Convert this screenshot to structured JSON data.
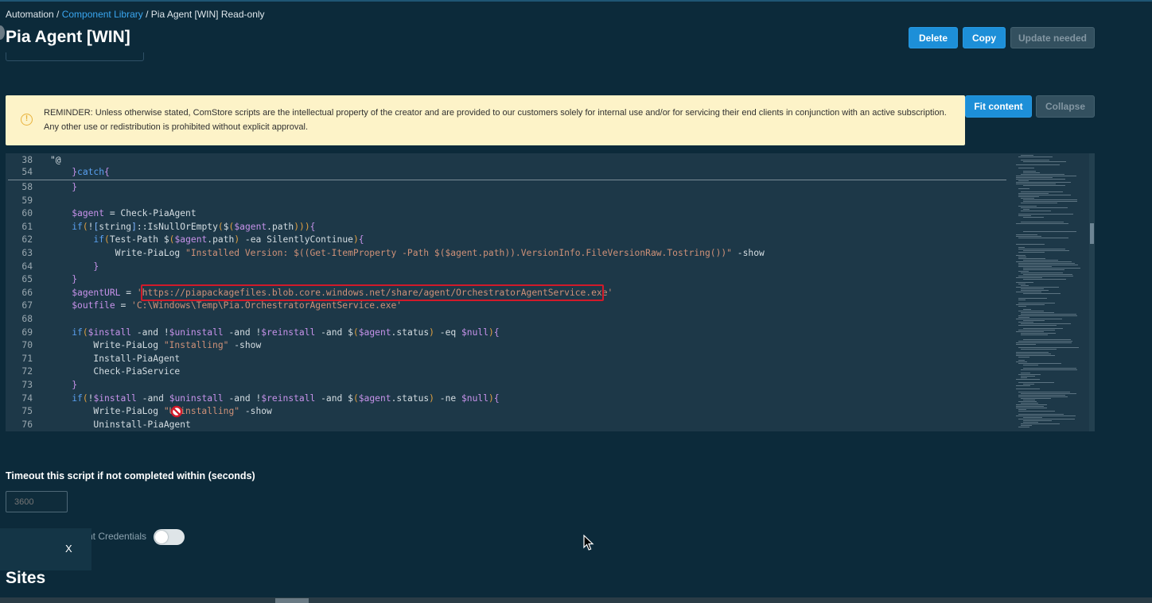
{
  "breadcrumb": {
    "root": "Automation",
    "sep1": " / ",
    "library": "Component Library",
    "sep2": " / ",
    "current": "Pia Agent [WIN] Read-only"
  },
  "page": {
    "title": "Pia Agent [WIN]"
  },
  "actions": {
    "delete_label": "Delete",
    "copy_label": "Copy",
    "update_label": "Update needed",
    "fit_label": "Fit content",
    "collapse_label": "Collapse"
  },
  "reminder": {
    "icon": "warning-circle-icon",
    "text": "REMINDER: Unless otherwise stated, ComStore scripts are the intellectual property of the creator and are provided to our customers solely for internal use and/or for servicing their end clients in conjunction with an active subscription. Any other use or redistribution is prohibited without explicit approval."
  },
  "editor": {
    "lines": [
      {
        "n": "38",
        "code": "\"@"
      },
      {
        "n": "54",
        "code": "    }catch{"
      },
      {
        "n": "58",
        "code": "    }"
      },
      {
        "n": "59",
        "code": ""
      },
      {
        "n": "60",
        "code": "    $agent = Check-PiaAgent"
      },
      {
        "n": "61",
        "code": "    if(![string]::IsNullOrEmpty($($agent.path))){"
      },
      {
        "n": "62",
        "code": "        if(Test-Path $($agent.path) -ea SilentlyContinue){"
      },
      {
        "n": "63",
        "code": "            Write-PiaLog \"Installed Version: $((Get-ItemProperty -Path $($agent.path)).VersionInfo.FileVersionRaw.Tostring())\" -show"
      },
      {
        "n": "64",
        "code": "        }"
      },
      {
        "n": "65",
        "code": "    }"
      },
      {
        "n": "66",
        "code": "    $agentURL = 'https://piapackagefiles.blob.core.windows.net/share/agent/OrchestratorAgentService.exe'"
      },
      {
        "n": "67",
        "code": "    $outfile = 'C:\\Windows\\Temp\\Pia.OrchestratorAgentService.exe'"
      },
      {
        "n": "68",
        "code": ""
      },
      {
        "n": "69",
        "code": "    if($install -and !$uninstall -and !$reinstall -and $($agent.status) -eq $null){"
      },
      {
        "n": "70",
        "code": "        Write-PiaLog \"Installing\" -show"
      },
      {
        "n": "71",
        "code": "        Install-PiaAgent"
      },
      {
        "n": "72",
        "code": "        Check-PiaService"
      },
      {
        "n": "73",
        "code": "    }"
      },
      {
        "n": "74",
        "code": "    if(!$install -and $uninstall -and !$reinstall -and $($agent.status) -ne $null){"
      },
      {
        "n": "75",
        "code": "        Write-PiaLog \"Uninstalling\" -show"
      },
      {
        "n": "76",
        "code": "        Uninstall-PiaAgent"
      }
    ]
  },
  "timeout": {
    "label": "Timeout this script if not completed within (seconds)",
    "value": "",
    "placeholder": "3600"
  },
  "credentials": {
    "label": "nt Credentials",
    "enabled": false
  },
  "toast": {
    "close_label": "X"
  },
  "sites": {
    "title": "Sites"
  },
  "colors": {
    "background": "#0c2a3a",
    "primary": "#1d8fd8",
    "reminder_bg": "#fdf3c8",
    "highlight": "#d11a2a",
    "editor_bg": "#1d3848"
  }
}
